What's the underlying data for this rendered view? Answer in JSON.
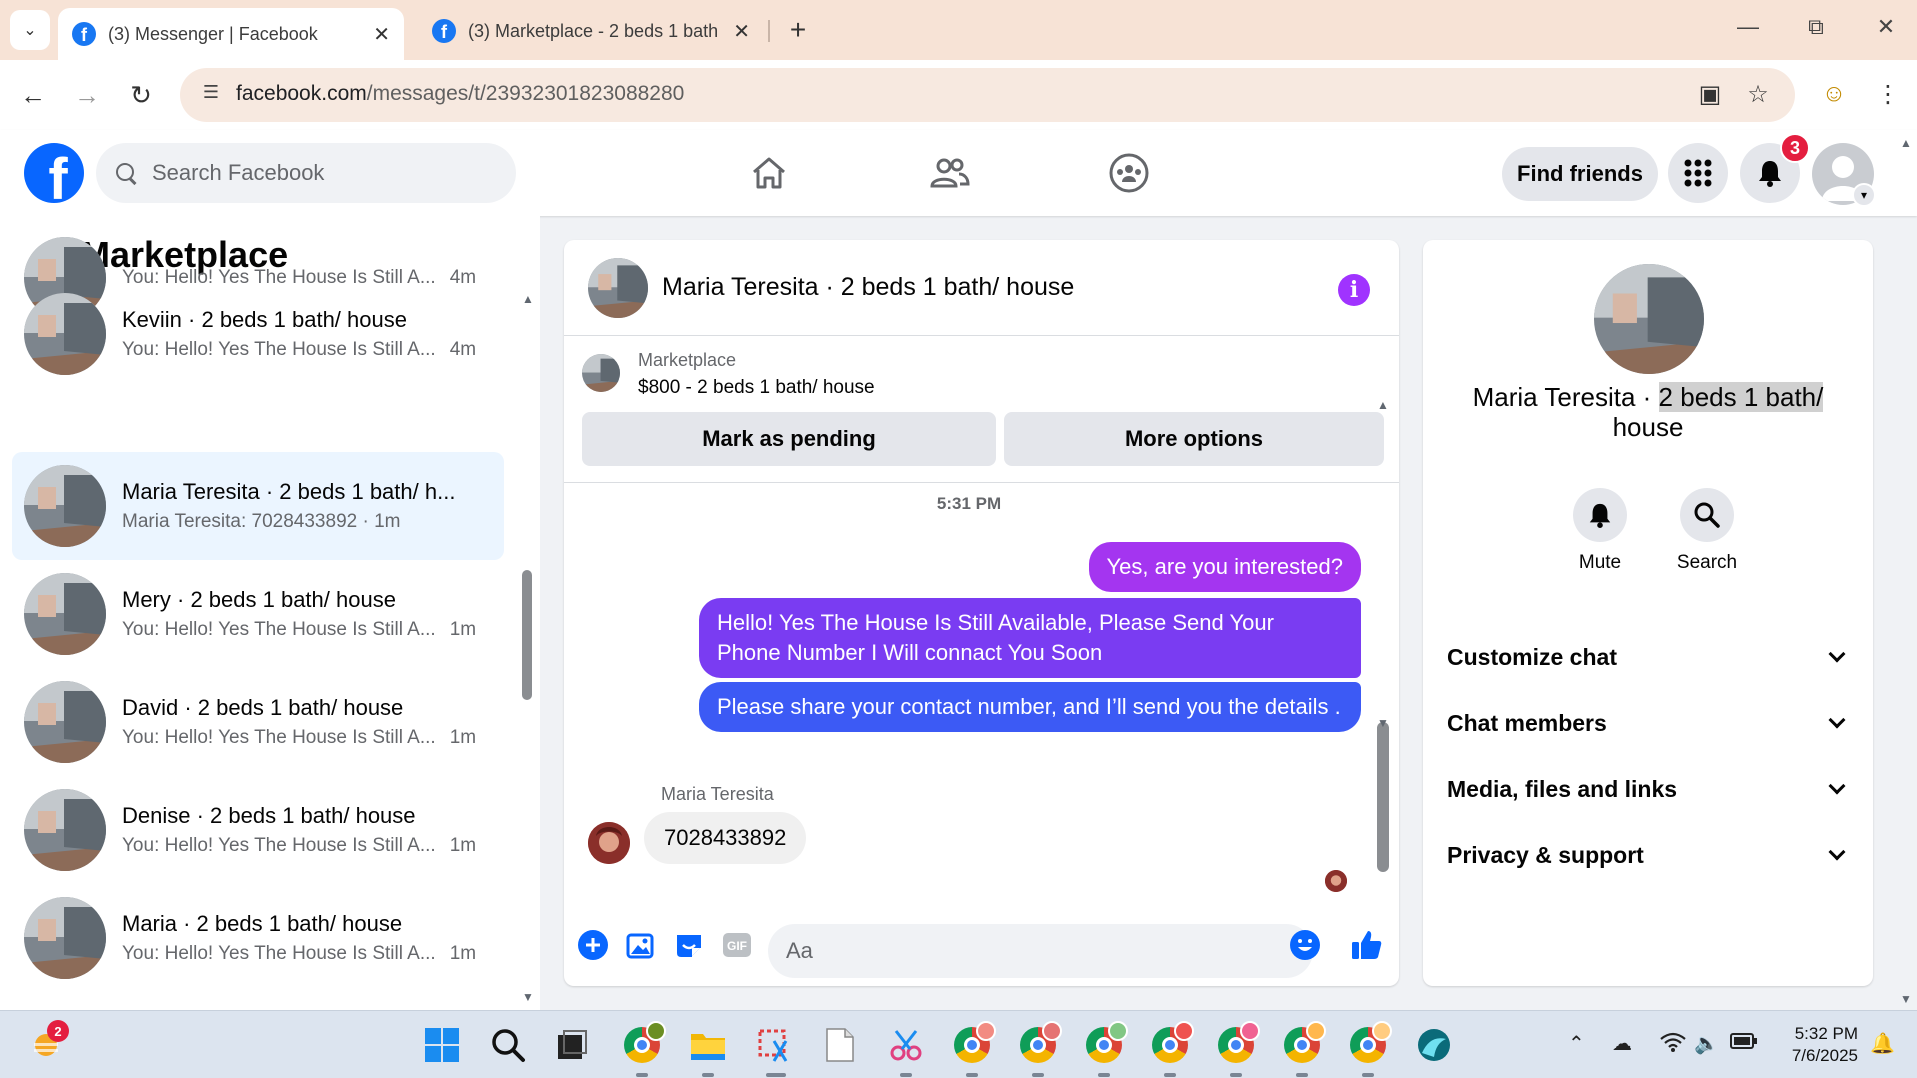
{
  "browser": {
    "tabs": [
      {
        "title": "(3) Messenger | Facebook",
        "active": true
      },
      {
        "title": "(3) Marketplace - 2 beds 1 bath",
        "active": false
      }
    ],
    "url_host": "facebook.com",
    "url_path": "/messages/t/23932301823088280"
  },
  "fb": {
    "search_placeholder": "Search Facebook",
    "find_friends": "Find friends",
    "notification_count": "3"
  },
  "left": {
    "title": "Marketplace",
    "conversations": [
      {
        "name": "",
        "preview": "You: Hello! Yes The House Is Still A...",
        "time": "4m"
      },
      {
        "name": "Keviin · 2 beds 1 bath/ house",
        "preview": "You: Hello! Yes The House Is Still A...",
        "time": "4m"
      },
      {
        "name": "Maria Teresita · 2 beds 1 bath/ h...",
        "preview": "Maria Teresita: 7028433892 · 1m",
        "time": ""
      },
      {
        "name": "Mery · 2 beds 1 bath/ house",
        "preview": "You: Hello! Yes The House Is Still A...",
        "time": "1m"
      },
      {
        "name": "David · 2 beds 1 bath/ house",
        "preview": "You: Hello! Yes The House Is Still A...",
        "time": "1m"
      },
      {
        "name": "Denise · 2 beds 1 bath/ house",
        "preview": "You: Hello! Yes The House Is Still A...",
        "time": "1m"
      },
      {
        "name": "Maria · 2 beds 1 bath/ house",
        "preview": "You: Hello! Yes The House Is Still A...",
        "time": "1m"
      }
    ]
  },
  "chat": {
    "title": "Maria Teresita · 2 beds 1 bath/ house",
    "marketplace_label": "Marketplace",
    "listing": "$800 - 2 beds 1 bath/ house",
    "mark_pending": "Mark as pending",
    "more_options": "More options",
    "timestamp": "5:31 PM",
    "outgoing": [
      "Yes, are you interested?",
      "Hello! Yes The House  Is Still Available, Please Send Your Phone Number I Will connact You Soon",
      "Please share your contact number, and I’ll send you the details ."
    ],
    "incoming_sender": "Maria Teresita",
    "incoming_message": "7028433892",
    "composer_placeholder": "Aa"
  },
  "info": {
    "name_part1": "Maria Teresita · ",
    "name_part2": "2 beds 1 bath/",
    "name_part3": "house",
    "mute": "Mute",
    "search": "Search",
    "sections": [
      "Customize chat",
      "Chat members",
      "Media, files and links",
      "Privacy & support"
    ]
  },
  "taskbar": {
    "weather_badge": "2",
    "time": "5:32 PM",
    "date": "7/6/2025"
  },
  "colors": {
    "fb_blue": "#0866ff",
    "bubble_top": "#a033ff",
    "bubble_bottom": "#3b5bff",
    "selected_row": "#ebf5ff"
  }
}
